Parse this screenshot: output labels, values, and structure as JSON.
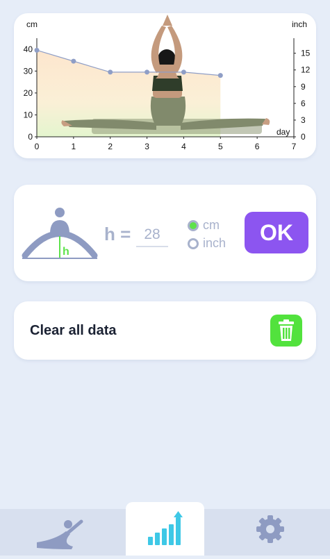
{
  "chart": {
    "left_unit": "cm",
    "right_unit": "inch",
    "x_unit": "day",
    "left_ticks": [
      "0",
      "10",
      "20",
      "30",
      "40"
    ],
    "right_ticks": [
      "0",
      "3",
      "6",
      "9",
      "12",
      "15"
    ],
    "x_ticks": [
      "0",
      "1",
      "2",
      "3",
      "4",
      "5",
      "6",
      "7"
    ]
  },
  "chart_data": {
    "type": "area",
    "x": [
      0,
      1,
      2,
      3,
      4,
      5
    ],
    "y": [
      39.5,
      34.5,
      29.5,
      29.5,
      29.5,
      28
    ],
    "xlabel": "day",
    "ylabel": "cm",
    "y2label": "inch",
    "xlim": [
      0,
      7
    ],
    "ylim": [
      0,
      45
    ],
    "y2lim": [
      0,
      17.7
    ],
    "colors": {
      "line": "#8f9ec6",
      "fill_top": "#fde3c8",
      "fill_bottom": "#e1f4c9"
    }
  },
  "input": {
    "h_label": "h =",
    "value": "28",
    "units": [
      {
        "label": "cm",
        "checked": true
      },
      {
        "label": "inch",
        "checked": false
      }
    ],
    "ok_label": "OK"
  },
  "clear": {
    "label": "Clear all data"
  },
  "nav": [
    {
      "icon": "stretch-icon",
      "active": false
    },
    {
      "icon": "progress-chart-icon",
      "active": true
    },
    {
      "icon": "gear-icon",
      "active": false
    }
  ],
  "colors": {
    "accent": "#8c55f0",
    "green": "#52e23d",
    "muted": "#a8b2cc",
    "background": "#e6edf8"
  }
}
